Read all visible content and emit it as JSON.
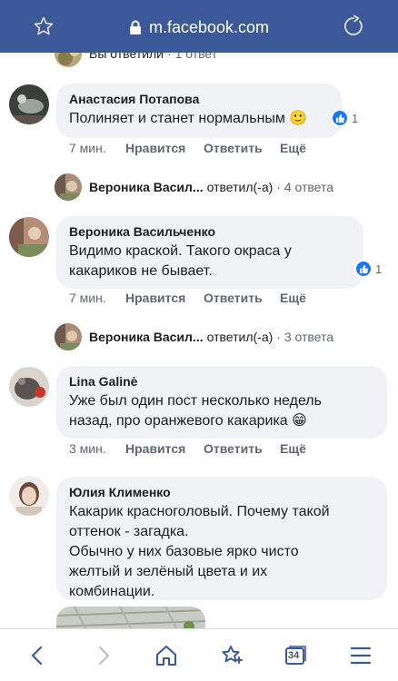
{
  "browser": {
    "url": "m.facebook.com"
  },
  "top_partial": {
    "text": "Вы ответили",
    "count": "· 1 ответ"
  },
  "comments": [
    {
      "author": "Анастасия Потапова",
      "text": "Полиняет и станет нормальным 🙂",
      "likes": "1",
      "time": "7 мин.",
      "like_label": "Нравится",
      "reply_label": "Ответить",
      "more_label": "Ещё",
      "replies": {
        "name": "Вероника Васил...",
        "verb": "ответил(-а)",
        "count": "· 4 ответа"
      }
    },
    {
      "author": "Вероника Васильченко",
      "text": "Видимо краской. Такого окраса у\nкакариков не бывает.",
      "likes": "1",
      "time": "7 мин.",
      "like_label": "Нравится",
      "reply_label": "Ответить",
      "more_label": "Ещё",
      "replies": {
        "name": "Вероника Васил...",
        "verb": "ответил(-а)",
        "count": "· 3 ответа"
      }
    },
    {
      "author": "Lina Galinė",
      "text": "Уже был один пост несколько недель\nназад, про оранжевого какарика 😁",
      "time": "3 мин.",
      "like_label": "Нравится",
      "reply_label": "Ответить",
      "more_label": "Ещё"
    },
    {
      "author": "Юлия Клименко",
      "text": "Какарик красноголовый. Почему такой\nоттенок - загадка.\nОбычно у них базовые ярко чисто\nжелтый и зелёный цвета и их\nкомбинации."
    }
  ],
  "bottom_nav": {
    "tabs_count": "34"
  },
  "colors": {
    "facebook_blue": "#3b5998",
    "like_blue": "#1877f2",
    "bubble_gray": "#f0f2f5"
  }
}
